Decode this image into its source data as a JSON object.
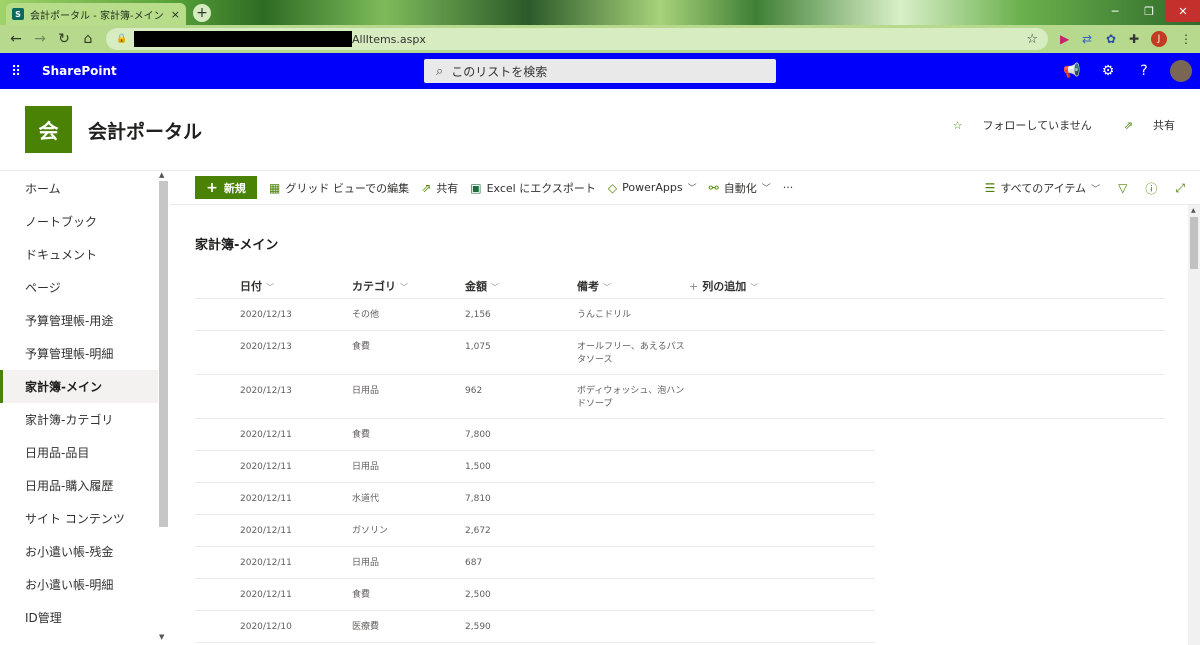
{
  "browser": {
    "tab_title": "会計ポータル - 家計簿-メイン - すべ",
    "tab_close": "×",
    "new_tab": "+",
    "url_suffix": "AllItems.aspx",
    "window": {
      "minimize": "─",
      "restore": "❐",
      "close": "✕"
    },
    "profile_initial": "J"
  },
  "suitebar": {
    "brand": "SharePoint",
    "search_placeholder": "このリストを検索"
  },
  "site": {
    "logo_char": "会",
    "title": "会計ポータル",
    "follow_label": "フォローしていません",
    "share_label": "共有"
  },
  "leftnav": {
    "items": [
      {
        "label": "ホーム",
        "selected": false
      },
      {
        "label": "ノートブック",
        "selected": false
      },
      {
        "label": "ドキュメント",
        "selected": false
      },
      {
        "label": "ページ",
        "selected": false
      },
      {
        "label": "予算管理帳-用途",
        "selected": false
      },
      {
        "label": "予算管理帳-明細",
        "selected": false
      },
      {
        "label": "家計簿-メイン",
        "selected": true
      },
      {
        "label": "家計簿-カテゴリ",
        "selected": false
      },
      {
        "label": "日用品-品目",
        "selected": false
      },
      {
        "label": "日用品-購入履歴",
        "selected": false
      },
      {
        "label": "サイト コンテンツ",
        "selected": false
      },
      {
        "label": "お小遣い帳-残金",
        "selected": false
      },
      {
        "label": "お小遣い帳-明細",
        "selected": false
      },
      {
        "label": "ID管理",
        "selected": false
      }
    ]
  },
  "commandbar": {
    "new_label": "新規",
    "grid_edit_label": "グリッド ビューでの編集",
    "share_label": "共有",
    "excel_label": "Excel にエクスポート",
    "powerapps_label": "PowerApps",
    "automate_label": "自動化",
    "more_label": "···",
    "view_label": "すべてのアイテム"
  },
  "list": {
    "title": "家計簿-メイン",
    "columns": [
      "日付",
      "カテゴリ",
      "金額",
      "備考"
    ],
    "add_column_label": "列の追加",
    "rows": [
      {
        "date": "2020/12/13",
        "category": "その他",
        "amount": "2,156",
        "note": "うんこドリル"
      },
      {
        "date": "2020/12/13",
        "category": "食費",
        "amount": "1,075",
        "note": "オールフリー、あえるパスタソース"
      },
      {
        "date": "2020/12/13",
        "category": "日用品",
        "amount": "962",
        "note": "ボディウォッシュ、泡ハンドソープ"
      },
      {
        "date": "2020/12/11",
        "category": "食費",
        "amount": "7,800",
        "note": ""
      },
      {
        "date": "2020/12/11",
        "category": "日用品",
        "amount": "1,500",
        "note": ""
      },
      {
        "date": "2020/12/11",
        "category": "水道代",
        "amount": "7,810",
        "note": ""
      },
      {
        "date": "2020/12/11",
        "category": "ガソリン",
        "amount": "2,672",
        "note": ""
      },
      {
        "date": "2020/12/11",
        "category": "日用品",
        "amount": "687",
        "note": ""
      },
      {
        "date": "2020/12/11",
        "category": "食費",
        "amount": "2,500",
        "note": ""
      },
      {
        "date": "2020/12/10",
        "category": "医療費",
        "amount": "2,590",
        "note": ""
      }
    ]
  }
}
